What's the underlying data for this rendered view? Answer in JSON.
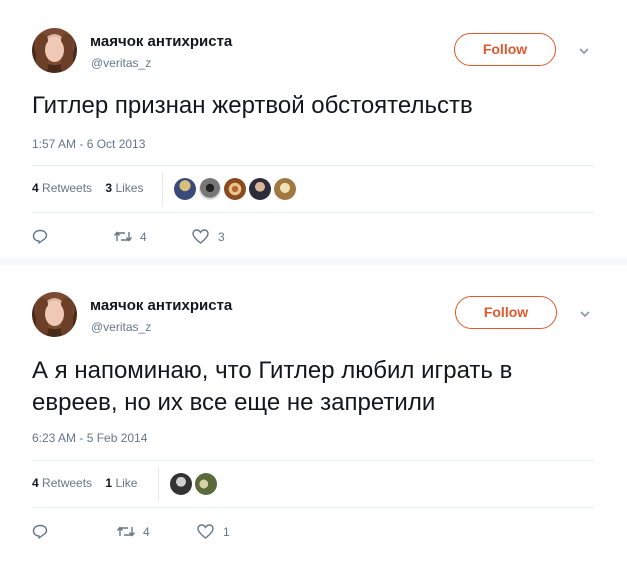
{
  "tweets": [
    {
      "name": "маячок антихриста",
      "handle": "@veritas_z",
      "follow_label": "Follow",
      "text": "Гитлер признан жертвой обстоятельств",
      "timestamp": "1:57 AM - 6 Oct 2013",
      "retweets_count": "4",
      "retweets_label": "Retweets",
      "likes_count": "3",
      "likes_label": "Likes",
      "reply_count": "",
      "retweet_action_count": "4",
      "like_action_count": "3",
      "likers": [
        "avatar-1",
        "avatar-2",
        "avatar-3",
        "avatar-4",
        "avatar-5"
      ]
    },
    {
      "name": "маячок антихриста",
      "handle": "@veritas_z",
      "follow_label": "Follow",
      "text": "А я напоминаю, что Гитлер любил играть в евреев, но их все еще не запретили",
      "timestamp": "6:23 AM - 5 Feb 2014",
      "retweets_count": "4",
      "retweets_label": "Retweets",
      "likes_count": "1",
      "likes_label": "Like",
      "reply_count": "",
      "retweet_action_count": "4",
      "like_action_count": "1",
      "likers": [
        "avatar-1",
        "avatar-2"
      ]
    }
  ],
  "colors": {
    "follow": "#e0582b",
    "muted": "#657786",
    "text": "#14171a",
    "divider": "#e6ecf0",
    "separator": "#f5f8fa"
  }
}
